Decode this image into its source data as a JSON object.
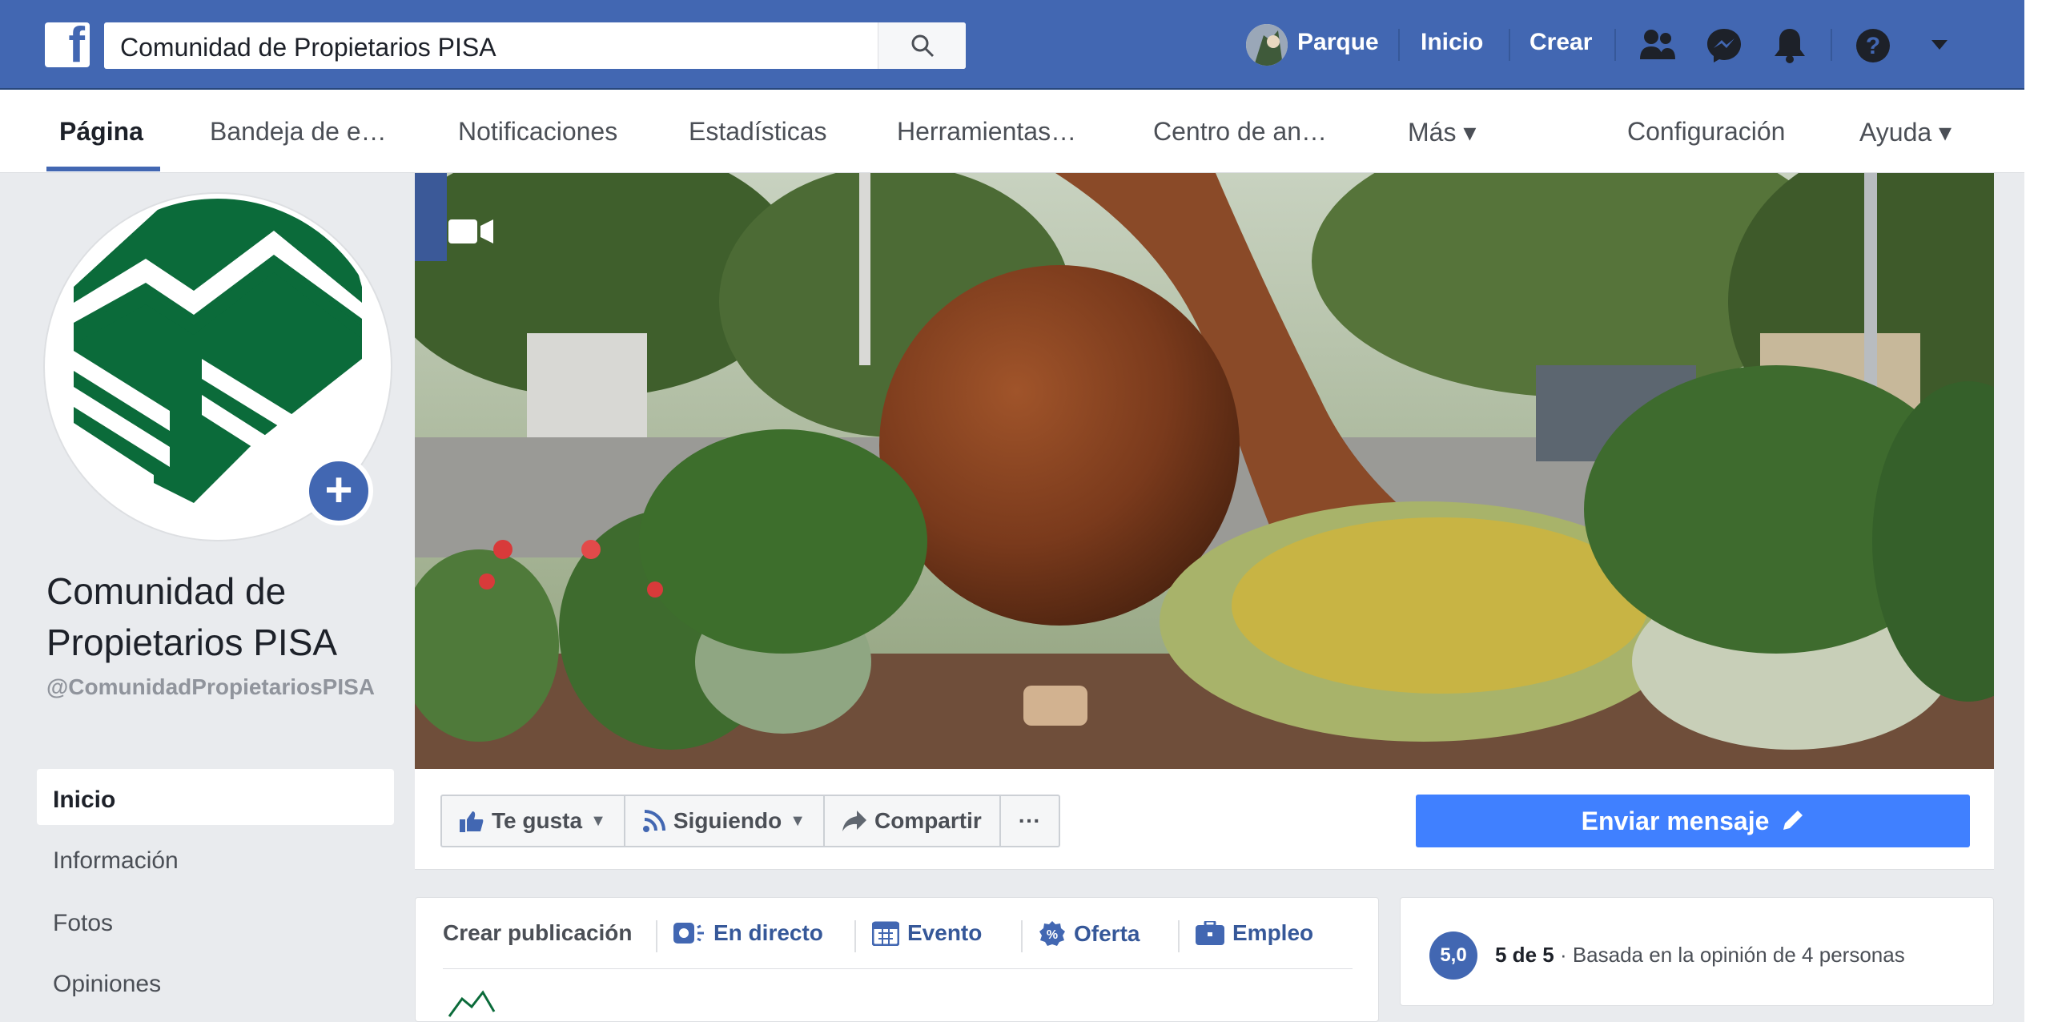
{
  "topbar": {
    "search_value": "Comunidad de Propietarios PISA",
    "profile_name": "Parque",
    "home_label": "Inicio",
    "create_label": "Crear"
  },
  "subnav": {
    "items": [
      "Página",
      "Bandeja de e…",
      "Notificaciones",
      "Estadísticas",
      "Herramientas…",
      "Centro de an…",
      "Más ▾",
      "Configuración",
      "Ayuda ▾"
    ]
  },
  "page": {
    "name": "Comunidad de Propietarios PISA",
    "handle": "@ComunidadPropietariosPISA"
  },
  "leftnav": {
    "items": [
      "Inicio",
      "Información",
      "Fotos",
      "Opiniones"
    ]
  },
  "actions": {
    "like_label": "Te gusta",
    "following_label": "Siguiendo",
    "share_label": "Compartir",
    "more_label": "···",
    "send_message_label": "Enviar mensaje"
  },
  "post": {
    "create_label": "Crear publicación",
    "live_label": "En directo",
    "event_label": "Evento",
    "offer_label": "Oferta",
    "job_label": "Empleo"
  },
  "rating": {
    "score": "5,0",
    "summary": "5 de 5",
    "detail": " · Basada en la opinión de 4 personas"
  },
  "colors": {
    "brand_blue": "#4267b2",
    "send_blue": "#4080ff",
    "logo_green": "#0b6b3a"
  }
}
